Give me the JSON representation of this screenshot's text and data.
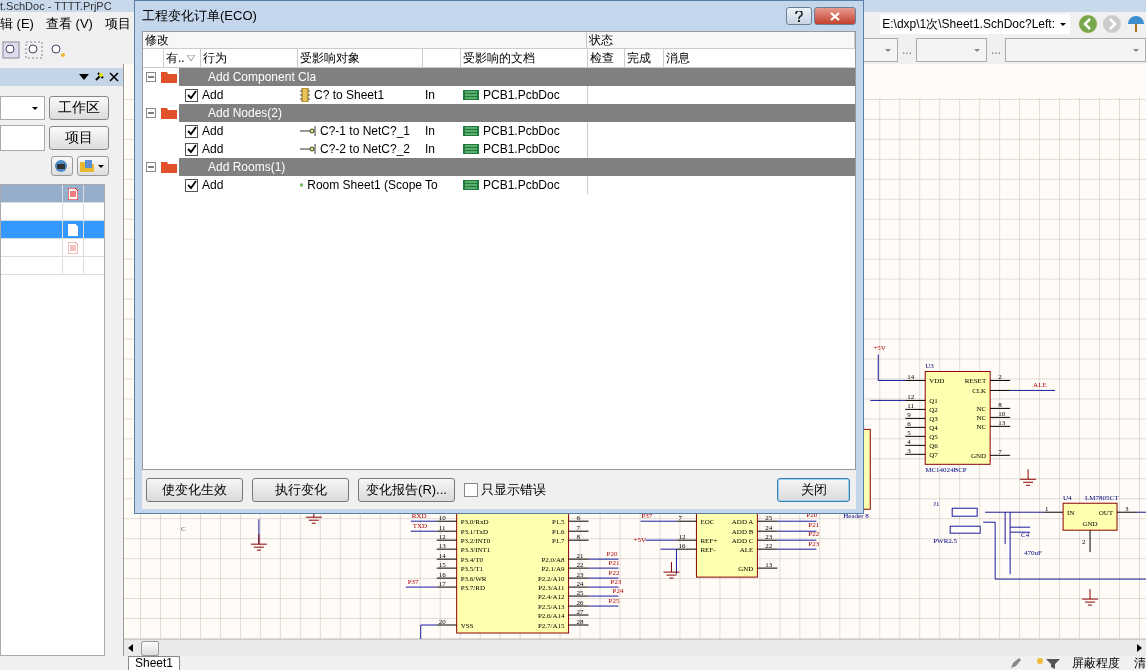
{
  "app": {
    "title": "t.SchDoc - TTTT.PrjPC"
  },
  "menu": [
    "辑 (E)",
    "查看 (V)",
    "项目"
  ],
  "address": {
    "value": "E:\\dxp\\1次\\Sheet1.SchDoc?Left:"
  },
  "filter_bar": {
    "separators": [
      "...",
      "..."
    ]
  },
  "panel": {
    "buttons": [
      "工作区",
      "项目"
    ],
    "rows": [
      {
        "selected": true
      },
      {
        "selected": false
      },
      {
        "selected": true
      },
      {
        "selected": false
      },
      {
        "selected": false
      }
    ]
  },
  "dialog": {
    "title": "工程变化订单(ECO)",
    "sections": [
      "修改",
      "状态"
    ],
    "columns": [
      "有..",
      "行为",
      "受影响对象",
      "受影响的文档",
      "检查",
      "完成",
      "消息"
    ],
    "rows": [
      {
        "kind": "group",
        "label": "Add Component Cla",
        "expanded": true
      },
      {
        "kind": "item",
        "checked": true,
        "action": "Add",
        "object": "C? to Sheet1",
        "direction": "In",
        "document": "PCB1.PcbDoc"
      },
      {
        "kind": "group",
        "label": "Add Nodes(2)",
        "expanded": true
      },
      {
        "kind": "item",
        "checked": true,
        "action": "Add",
        "object": "C?-1 to NetC?_1",
        "direction": "In",
        "document": "PCB1.PcbDoc"
      },
      {
        "kind": "item",
        "checked": true,
        "action": "Add",
        "object": "C?-2 to NetC?_2",
        "direction": "In",
        "document": "PCB1.PcbDoc"
      },
      {
        "kind": "group",
        "label": "Add Rooms(1)",
        "expanded": true
      },
      {
        "kind": "item",
        "checked": true,
        "action": "Add",
        "object": "Room Sheet1 (Scope",
        "direction": "To",
        "document": "PCB1.PcbDoc"
      }
    ],
    "buttons": [
      "使变化生效",
      "执行变化",
      "变化报告(R)..."
    ],
    "errors_only": {
      "label": "只显示错误",
      "checked": false
    },
    "close": "关闭"
  },
  "schematic": {
    "chips": [
      {
        "designator": "U3",
        "part": "MC14024BCP",
        "left": [
          {
            "num": "14",
            "name": "VDD"
          },
          {
            "num": "12",
            "name": "Q1"
          },
          {
            "num": "11",
            "name": "Q2"
          },
          {
            "num": "9",
            "name": "Q3"
          },
          {
            "num": "6",
            "name": "Q4"
          },
          {
            "num": "5",
            "name": "Q5"
          },
          {
            "num": "4",
            "name": "Q6"
          },
          {
            "num": "3",
            "name": "Q7"
          }
        ],
        "right": [
          {
            "num": "2",
            "name": "RESET"
          },
          {
            "name": "CLK"
          },
          {
            "num": "8",
            "name": "NC"
          },
          {
            "num": "10",
            "name": "NC"
          },
          {
            "num": "13",
            "name": "NC"
          },
          {
            "num": "7",
            "name": "GND"
          }
        ]
      },
      {
        "designator": "U4",
        "part": "LM7805CT",
        "left": [
          {
            "num": "1",
            "name": "IN"
          }
        ],
        "right": [
          {
            "num": "3",
            "name": "OUT"
          }
        ],
        "bottom": [
          {
            "num": "2",
            "name": "GND"
          }
        ]
      },
      {
        "left": [
          {
            "num": "10",
            "name": "P3.0/RxD"
          },
          {
            "num": "11",
            "name": "P3.1/TxD"
          },
          {
            "num": "12",
            "name": "P3.2/INT0"
          },
          {
            "num": "13",
            "name": "P3.3/INT1"
          },
          {
            "num": "14",
            "name": "P3.4/T0"
          },
          {
            "num": "15",
            "name": "P3.5/T1"
          },
          {
            "num": "16",
            "name": "P3.6/WR"
          },
          {
            "num": "17",
            "name": "P3.7/RD"
          },
          {
            "num": "20",
            "name": "VSS"
          }
        ],
        "right": [
          {
            "num": "6",
            "name": "P1.5"
          },
          {
            "num": "7",
            "name": "P1.6"
          },
          {
            "num": "8",
            "name": "P1.7"
          },
          {
            "num": "21",
            "name": "P2.0/A8"
          },
          {
            "num": "22",
            "name": "P2.1/A9"
          },
          {
            "num": "23",
            "name": "P2.2/A10"
          },
          {
            "num": "24",
            "name": "P2.3/A11"
          },
          {
            "num": "25",
            "name": "P2.4/A12"
          },
          {
            "num": "26",
            "name": "P2.5/A13"
          },
          {
            "num": "27",
            "name": "P2.6/A14"
          },
          {
            "num": "28",
            "name": "P2.7/A15"
          }
        ]
      },
      {
        "left": [
          {
            "num": "7",
            "name": "EOC"
          },
          {
            "num": "12",
            "name": "REF+"
          },
          {
            "num": "16",
            "name": "REF-"
          }
        ],
        "right": [
          {
            "num": "25",
            "name": "ADD A"
          },
          {
            "num": "24",
            "name": "ADD B"
          },
          {
            "num": "23",
            "name": "ADD C"
          },
          {
            "num": "22",
            "name": "ALE"
          },
          {
            "num": "13",
            "name": "GND"
          }
        ]
      }
    ],
    "labels": [
      {
        "text": "+5V",
        "kind": "net"
      },
      {
        "text": "ALE",
        "kind": "net"
      },
      {
        "text": "J1",
        "kind": "designator"
      },
      {
        "text": "RXD",
        "kind": "net"
      },
      {
        "text": "P37",
        "kind": "net"
      },
      {
        "text": "P20",
        "kind": "net"
      },
      {
        "text": "Header 8",
        "kind": "part"
      },
      {
        "text": "C",
        "kind": "border"
      },
      {
        "text": "TXD",
        "kind": "net"
      },
      {
        "text": "P21",
        "kind": "net"
      },
      {
        "text": "P22",
        "kind": "net"
      },
      {
        "text": "C4",
        "kind": "designator"
      },
      {
        "text": "+5V",
        "kind": "net"
      },
      {
        "text": "PWR2.5",
        "kind": "part"
      },
      {
        "text": "P23",
        "kind": "net"
      },
      {
        "text": "P20",
        "kind": "net"
      },
      {
        "text": "470uF",
        "kind": "part"
      },
      {
        "text": "P21",
        "kind": "net"
      },
      {
        "text": "P22",
        "kind": "net"
      },
      {
        "text": "P37",
        "kind": "net"
      },
      {
        "text": "P23",
        "kind": "net"
      },
      {
        "text": "P24",
        "kind": "net"
      },
      {
        "text": "P25",
        "kind": "net"
      }
    ]
  },
  "tabs": [
    {
      "label": "Sheet1",
      "selected": true
    }
  ],
  "status": [
    "屏蔽程度",
    "清"
  ]
}
